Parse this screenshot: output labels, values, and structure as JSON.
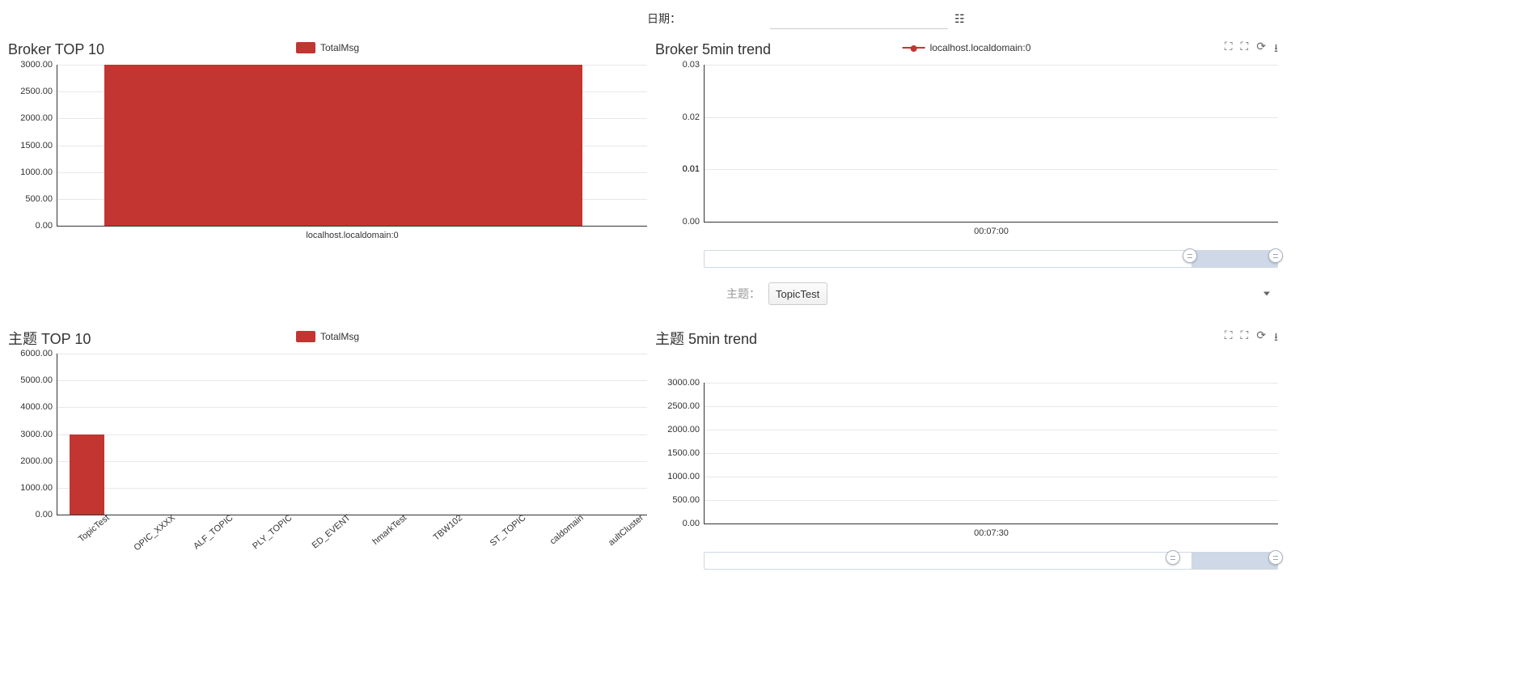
{
  "top": {
    "date_label": "日期：",
    "date_value": ""
  },
  "panels": {
    "brokerTop": {
      "title": "Broker TOP 10",
      "legend": "TotalMsg"
    },
    "brokerTrend": {
      "title": "Broker 5min trend",
      "legend": "localhost.localdomain:0"
    },
    "topicTop": {
      "title": "主题 TOP 10",
      "legend": "TotalMsg"
    },
    "topicTrend": {
      "title": "主题 5min trend"
    }
  },
  "topic_row": {
    "label": "主题：",
    "selected": "TopicTest"
  },
  "chart_data": [
    {
      "id": "brokerTop",
      "type": "bar",
      "title": "Broker TOP 10",
      "legend": [
        "TotalMsg"
      ],
      "categories": [
        "localhost.localdomain:0"
      ],
      "values": [
        3000
      ],
      "y_ticks": [
        0.0,
        500.0,
        1000.0,
        1500.0,
        2000.0,
        2500.0,
        3000.0
      ],
      "ylim": [
        0,
        3000
      ],
      "x_center_label": "localhost.localdomain:0"
    },
    {
      "id": "brokerTrend",
      "type": "line",
      "title": "Broker 5min trend",
      "legend": [
        "localhost.localdomain:0"
      ],
      "x": [
        "00:07:00"
      ],
      "series": [
        {
          "name": "localhost.localdomain:0",
          "values": [
            0
          ]
        }
      ],
      "y_ticks": [
        0.0,
        0.01,
        0.01,
        0.01,
        0.02,
        0.03
      ],
      "ylim": [
        0,
        0.03
      ],
      "x_center_label": "00:07:00",
      "slider_range": [
        0.85,
        1.0
      ]
    },
    {
      "id": "topicTop",
      "type": "bar",
      "title": "主题 TOP 10",
      "legend": [
        "TotalMsg"
      ],
      "categories": [
        "TopicTest",
        "OPIC_XXXX",
        "ALF_TOPIC",
        "PLY_TOPIC",
        "ED_EVENT",
        "hmarkTest",
        "TBW102",
        "ST_TOPIC",
        "caldomain",
        "aultCluster"
      ],
      "values": [
        3000,
        0,
        0,
        0,
        0,
        0,
        0,
        0,
        0,
        0
      ],
      "y_ticks": [
        0.0,
        1000.0,
        2000.0,
        3000.0,
        4000.0,
        5000.0,
        6000.0
      ],
      "ylim": [
        0,
        6000
      ]
    },
    {
      "id": "topicTrend",
      "type": "line",
      "title": "主题 5min trend",
      "legend": [],
      "x": [
        "00:07:30"
      ],
      "series": [],
      "y_ticks": [
        0.0,
        500.0,
        1000.0,
        1500.0,
        2000.0,
        2500.0,
        3000.0
      ],
      "ylim": [
        0,
        3000
      ],
      "x_center_label": "00:07:30",
      "slider_range": [
        0.82,
        1.0
      ]
    }
  ]
}
